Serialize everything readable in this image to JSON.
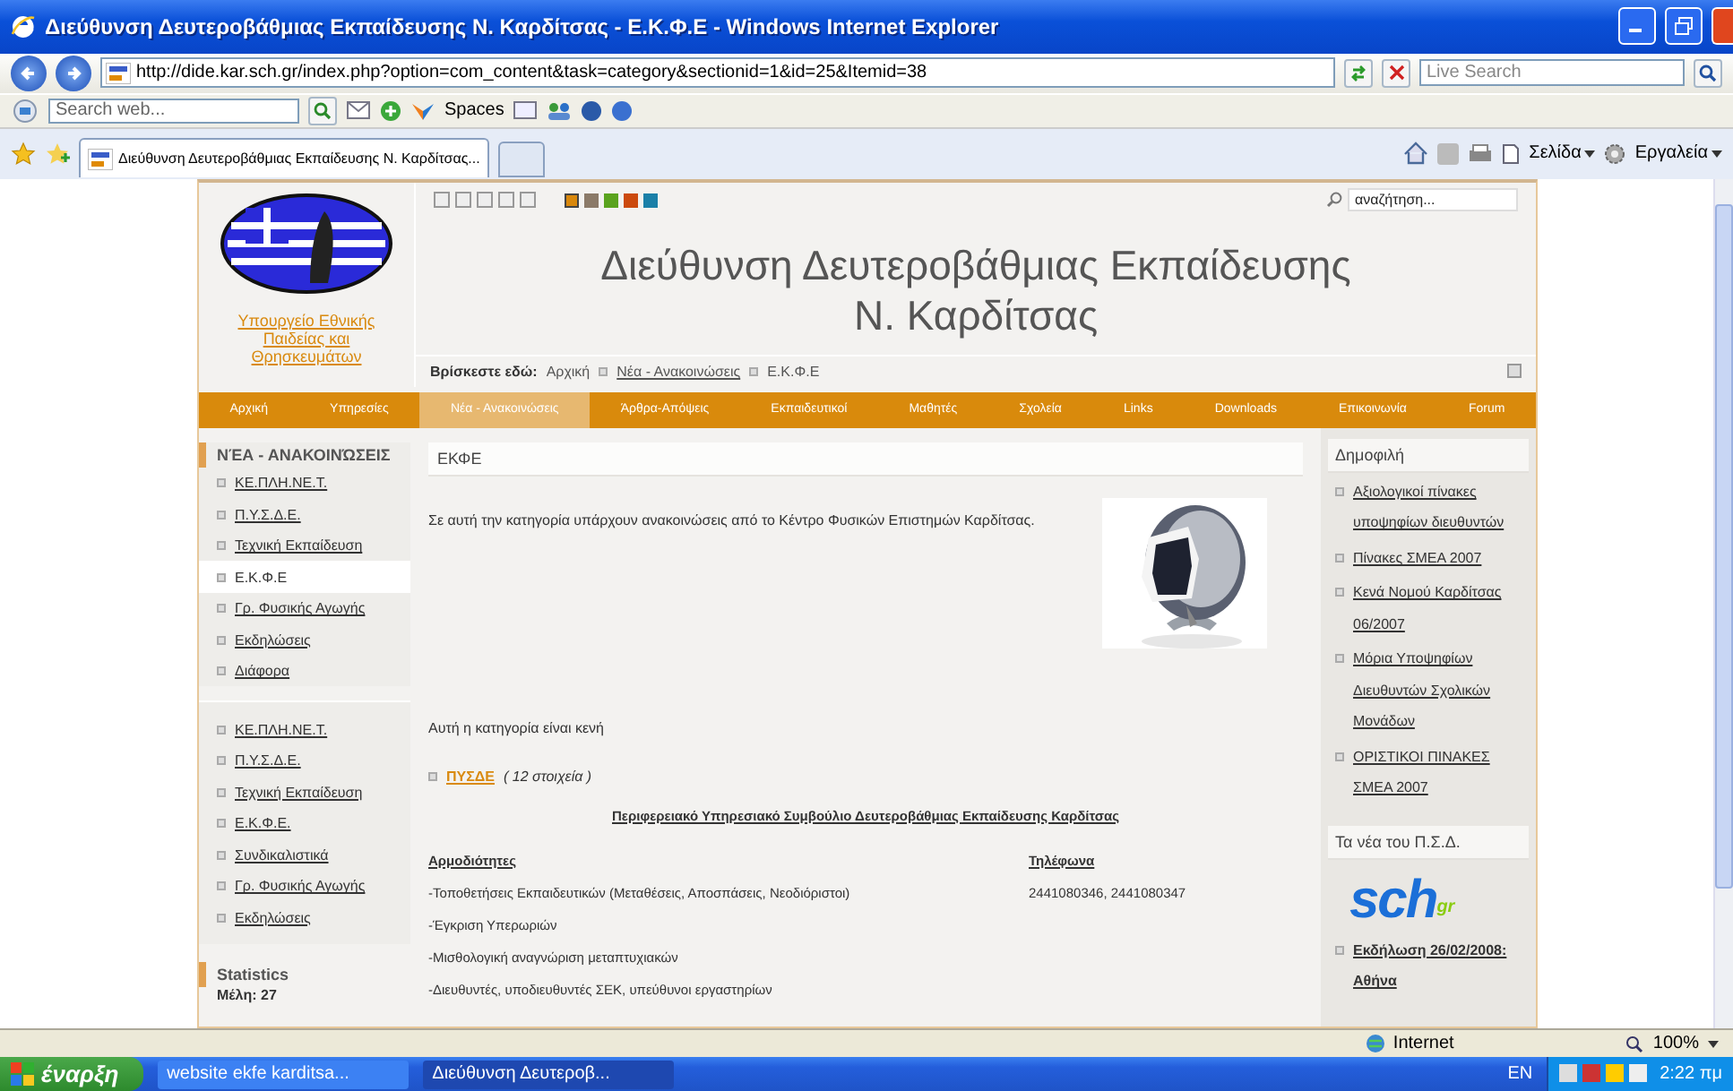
{
  "window": {
    "title": "Διεύθυνση Δευτεροβάθμιας Εκπαίδευσης Ν. Καρδίτσας - Ε.Κ.Φ.Ε - Windows Internet Explorer"
  },
  "address_bar": {
    "url": "http://dide.kar.sch.gr/index.php?option=com_content&task=category&sectionid=1&id=25&Itemid=38",
    "search_placeholder": "Live Search"
  },
  "toolbar": {
    "search_placeholder": "Search web...",
    "spaces": "Spaces"
  },
  "tabs": [
    {
      "label": "Διεύθυνση Δευτεροβάθμιας Εκπαίδευσης Ν. Καρδίτσας...",
      "selected": true
    }
  ],
  "command_bar": [
    "Σελίδα",
    "Εργαλεία"
  ],
  "site": {
    "ministry_link": "Υπουργείο Εθνικής Παιδείας και Θρησκευμάτων",
    "theme_colors": [
      {
        "color": "#d9880c",
        "selected": true
      },
      {
        "color": "#8b7a68",
        "selected": false
      },
      {
        "color": "#5aa31e",
        "selected": false
      },
      {
        "color": "#cc4a0e",
        "selected": false
      },
      {
        "color": "#1a80a8",
        "selected": false
      }
    ],
    "search_placeholder": "αναζήτηση...",
    "title_lines": [
      "Διεύθυνση Δευτεροβάθμιας Εκπαίδευσης",
      "Ν. Καρδίτσας"
    ],
    "breadcrumb": {
      "label": "Βρίσκεστε εδώ:",
      "items": [
        {
          "text": "Αρχική",
          "link": false
        },
        {
          "text": "Νέα - Ανακοινώσεις",
          "link": true
        },
        {
          "text": "Ε.Κ.Φ.Ε",
          "link": false
        }
      ]
    },
    "nav": [
      {
        "label": "Αρχική",
        "selected": false
      },
      {
        "label": "Υπηρεσίες",
        "selected": false
      },
      {
        "label": "Νέα - Ανακοινώσεις",
        "selected": true
      },
      {
        "label": "Άρθρα-Απόψεις",
        "selected": false
      },
      {
        "label": "Εκπαιδευτικοί",
        "selected": false
      },
      {
        "label": "Μαθητές",
        "selected": false
      },
      {
        "label": "Σχολεία",
        "selected": false
      },
      {
        "label": "Links",
        "selected": false
      },
      {
        "label": "Downloads",
        "selected": false
      },
      {
        "label": "Επικοινωνία",
        "selected": false
      },
      {
        "label": "Forum",
        "selected": false
      }
    ],
    "left_menu": {
      "title": "ΝΈΑ - ΑΝΑΚΟΙΝΏΣΕΙΣ",
      "items": [
        {
          "label": "ΚΕ.ΠΛΗ.ΝΕ.Τ.",
          "selected": false
        },
        {
          "label": "Π.Υ.Σ.Δ.Ε.",
          "selected": false
        },
        {
          "label": "Τεχνική Εκπαίδευση",
          "selected": false
        },
        {
          "label": "Ε.Κ.Φ.Ε",
          "selected": true
        },
        {
          "label": "Γρ. Φυσικής Αγωγής",
          "selected": false
        },
        {
          "label": "Εκδηλώσεις",
          "selected": false
        },
        {
          "label": "Διάφορα",
          "selected": false
        }
      ]
    },
    "left_menu_2": {
      "items": [
        "ΚΕ.ΠΛΗ.ΝΕ.Τ.",
        "Π.Υ.Σ.Δ.Ε.",
        "Τεχνική Εκπαίδευση",
        "Ε.Κ.Φ.Ε.",
        "Συνδικαλιστικά",
        "Γρ. Φυσικής Αγωγής",
        "Εκδηλώσεις"
      ]
    },
    "statistics": {
      "title": "Statistics",
      "members": "Μέλη: 27"
    },
    "article": {
      "heading": "ΕΚΦΕ",
      "intro": "Σε αυτή την κατηγορία υπάρχουν ανακοινώσεις από το Κέντρο Φυσικών Επιστημών Καρδίτσας.",
      "image": {
        "kind": "picture"
      },
      "empty_note": "Αυτή η κατηγορία είναι κενή",
      "category": {
        "link": "ΠΥΣΔΕ",
        "count": "( 12 στοιχεία )"
      },
      "council_title": "Περιφερειακό Υπηρεσιακό Συμβούλιο Δευτεροβάθμιας Εκπαίδευσης Καρδίτσας",
      "columns": [
        "Αρμοδιότητες",
        "Τηλέφωνα"
      ],
      "rows": [
        {
          "duty": "-Τοποθετήσεις Εκπαιδευτικών (Μεταθέσεις, Αποσπάσεις, Νεοδιόριστοι)",
          "phone": "2441080346, 2441080347"
        },
        {
          "duty": "-Έγκριση Υπερωριών"
        },
        {
          "duty": "-Μισθολογική αναγνώριση μεταπτυχιακών"
        },
        {
          "duty": "-Διευθυντές, υποδιευθυντές ΣΕΚ, υπεύθυνοι εργαστηρίων"
        }
      ]
    },
    "popular": {
      "title": "Δημοφιλή",
      "items": [
        "Αξιολογικοί πίνακες υποψηφίων διευθυντών",
        "Πίνακες ΣΜΕΑ 2007",
        "Κενά Νομού Καρδίτσας 06/2007",
        "Μόρια Υποψηφίων Διευθυντών Σχολικών Μονάδων",
        "ΟΡΙΣΤΙΚΟΙ ΠΙΝΑΚΕΣ ΣΜΕΑ 2007"
      ]
    },
    "psd_news": {
      "title": "Τα νέα του Π.Σ.Δ.",
      "logo": {
        "main": "sch",
        "suffix": "gr"
      },
      "items": [
        "Εκδήλωση 26/02/2008: Αθήνα"
      ]
    }
  },
  "status_bar": {
    "zone": "Internet",
    "zoom": "100%"
  },
  "taskbar": {
    "start": "έναρξη",
    "windows": [
      {
        "label": "website ekfe karditsa...",
        "selected": false
      },
      {
        "label": "Διεύθυνση Δευτεροβ...",
        "selected": true
      }
    ],
    "language": "EN",
    "clock": "2:22 πμ"
  }
}
